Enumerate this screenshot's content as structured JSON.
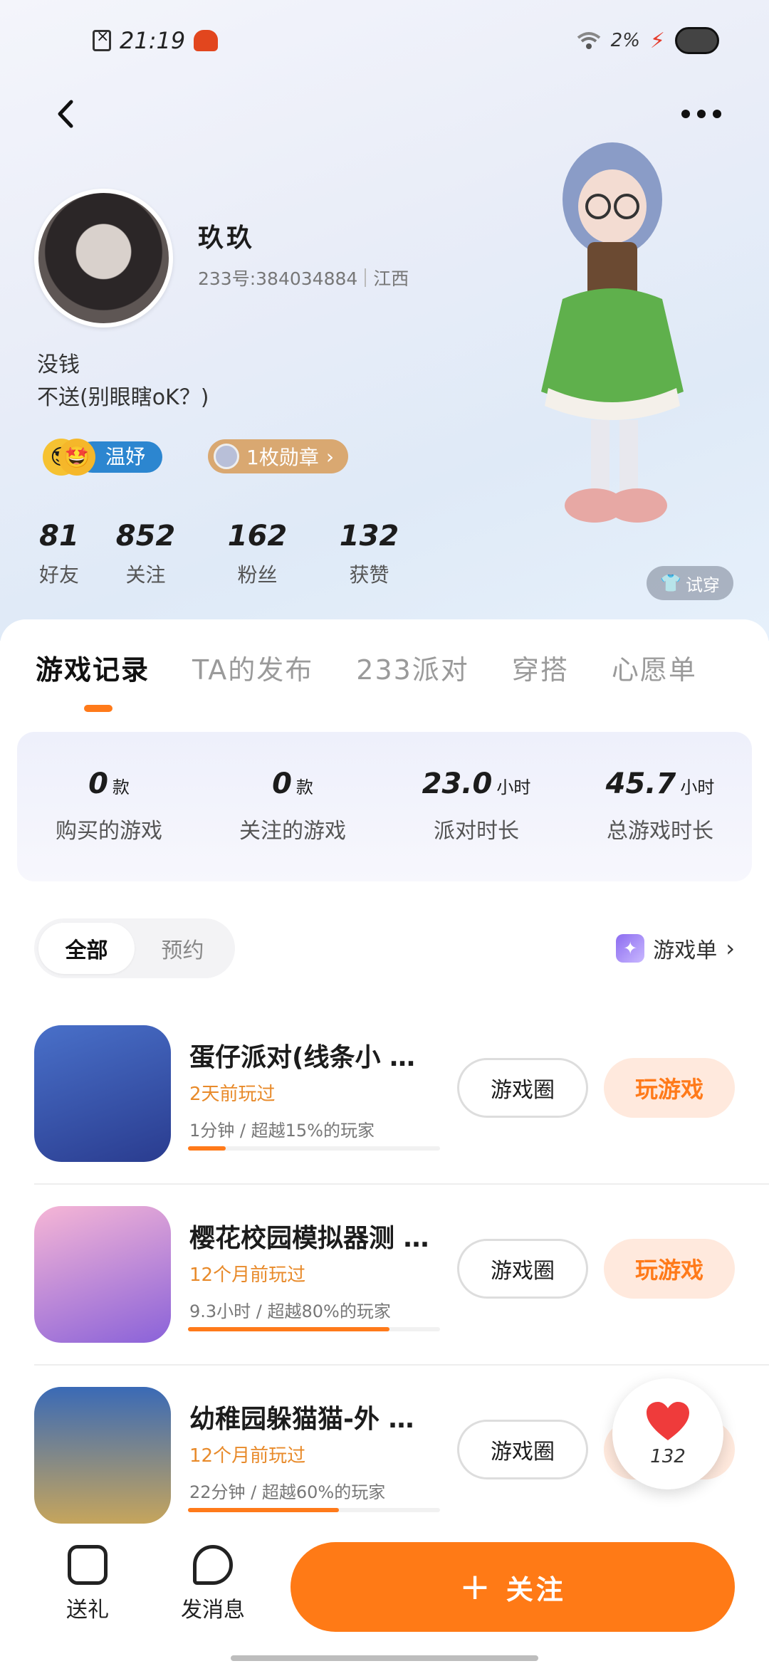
{
  "status_bar": {
    "time": "21:19",
    "battery": "2%"
  },
  "profile": {
    "name": "玖玖",
    "uid": "233号:384034884",
    "location": "江西",
    "bio_line1": "没钱",
    "bio_line2": "不送(别眼瞎oK？)",
    "mood_label": "温妤",
    "medal_label": "1枚勋章",
    "tryon_label": "试穿"
  },
  "stats": [
    {
      "value": "81",
      "label": "好友"
    },
    {
      "value": "852",
      "label": "关注"
    },
    {
      "value": "162",
      "label": "粉丝"
    },
    {
      "value": "132",
      "label": "获赞"
    }
  ],
  "tabs": [
    "游戏记录",
    "TA的发布",
    "233派对",
    "穿搭",
    "心愿单"
  ],
  "summary": [
    {
      "value": "0",
      "unit": "款",
      "label": "购买的游戏"
    },
    {
      "value": "0",
      "unit": "款",
      "label": "关注的游戏"
    },
    {
      "value": "23.0",
      "unit": "小时",
      "label": "派对时长"
    },
    {
      "value": "45.7",
      "unit": "小时",
      "label": "总游戏时长"
    }
  ],
  "filter": {
    "all": "全部",
    "reserve": "预约",
    "gamelist": "游戏单"
  },
  "games": [
    {
      "title": "蛋仔派对(线条小 …",
      "last_played": "2天前玩过",
      "meta": "1分钟 / 超越15%的玩家",
      "progress": 0.15,
      "circle_btn": "游戏圈",
      "play_btn": "玩游戏"
    },
    {
      "title": "樱花校园模拟器测 …",
      "last_played": "12个月前玩过",
      "meta": "9.3小时 / 超越80%的玩家",
      "progress": 0.8,
      "circle_btn": "游戏圈",
      "play_btn": "玩游戏"
    },
    {
      "title": "幼稚园躲猫猫-外 …",
      "last_played": "12个月前玩过",
      "meta": "22分钟 / 超越60%的玩家",
      "progress": 0.6,
      "circle_btn": "游戏圈",
      "play_btn": "玩游戏"
    }
  ],
  "like_float": {
    "count": "132"
  },
  "bottom": {
    "gift": "送礼",
    "message": "发消息",
    "follow": "关注"
  },
  "colors": {
    "accent": "#ff7a16",
    "accent_light": "#ffe9dd",
    "last_played": "#e88a2a",
    "mood_badge": "#2c86d0",
    "medal_badge": "#d9a871"
  }
}
